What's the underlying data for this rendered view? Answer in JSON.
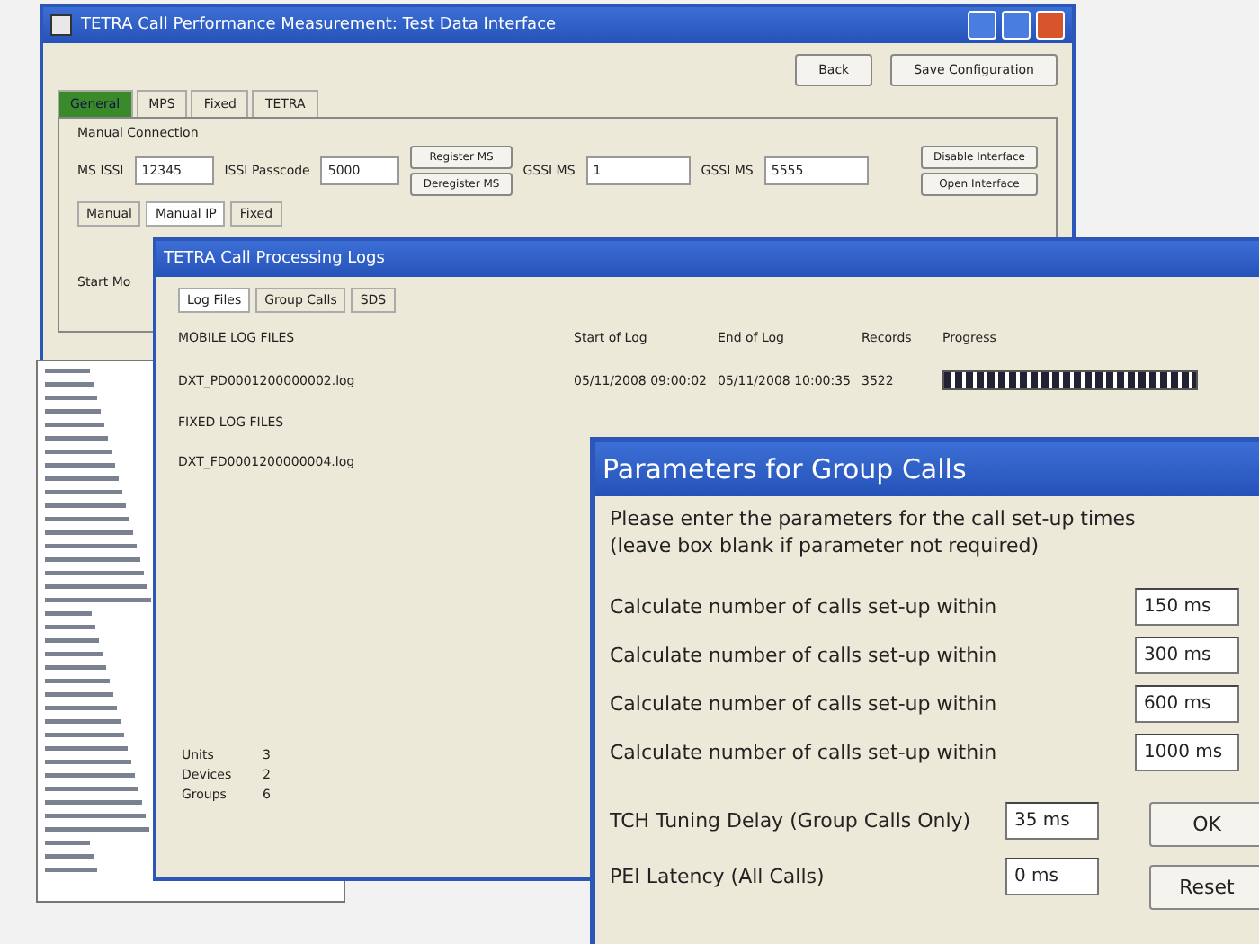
{
  "main_window": {
    "title": "TETRA Call Performance Measurement: Test Data Interface",
    "buttons": [
      "Back",
      "Save Configuration"
    ],
    "tabs": [
      {
        "label": "General",
        "selected": true
      },
      {
        "label": "MPS",
        "selected": false
      },
      {
        "label": "Fixed",
        "selected": false
      },
      {
        "label": "TETRA",
        "selected": false
      }
    ],
    "group_label": "Manual Connection",
    "fields": [
      {
        "label": "MS ISSI",
        "value": "12345"
      },
      {
        "label": "ISSI Passcode",
        "value": "5000"
      }
    ],
    "register_buttons": [
      "Register MS",
      "Deregister MS"
    ],
    "gssi_fields": [
      {
        "label": "GSSI MS",
        "value": "1"
      },
      {
        "label": "GSSI MS",
        "value": "5555"
      }
    ],
    "interface_buttons": [
      "Disable Interface",
      "Open Interface"
    ],
    "sub_tabs": [
      {
        "label": "Manual",
        "selected": false
      },
      {
        "label": "Manual IP",
        "selected": true
      },
      {
        "label": "Fixed",
        "selected": false
      }
    ],
    "partial_label": "Start Mo"
  },
  "log_window": {
    "title": "TETRA Call Processing Logs",
    "tabs": [
      {
        "label": "Log Files",
        "selected": true
      },
      {
        "label": "Group Calls",
        "selected": false
      },
      {
        "label": "SDS",
        "selected": false
      }
    ],
    "columns": [
      "Start of Log",
      "End of Log",
      "Records",
      "Progress"
    ],
    "sections": [
      {
        "heading": "MOBILE LOG FILES",
        "file": "DXT_PD0001200000002.log",
        "start": "05/11/2008 09:00:02",
        "end": "05/11/2008 10:00:35",
        "records": "3522",
        "level": 1
      },
      {
        "heading": "FIXED LOG FILES",
        "file": "DXT_FD0001200000004.log"
      }
    ],
    "stats": [
      {
        "label": "Units",
        "value": "3"
      },
      {
        "label": "Devices",
        "value": "2"
      },
      {
        "label": "Groups",
        "value": "6"
      }
    ]
  },
  "dialog": {
    "title": "Parameters for Group Calls",
    "intro": [
      "Please enter the parameters for the call set-up times",
      "(leave box blank if parameter not required)"
    ],
    "rows": [
      {
        "label": "Calculate number of calls set-up within",
        "value": "150 ms"
      },
      {
        "label": "Calculate number of calls set-up within",
        "value": "300 ms"
      },
      {
        "label": "Calculate number of calls set-up within",
        "value": "600 ms"
      },
      {
        "label": "Calculate number of calls set-up within",
        "value": "1000 ms"
      }
    ],
    "delays": [
      {
        "label": "TCH Tuning Delay (Group Calls Only)",
        "value": "35 ms"
      },
      {
        "label": "PEI Latency (All Calls)",
        "value": "0 ms"
      }
    ],
    "buttons": [
      "OK",
      "Reset"
    ]
  }
}
